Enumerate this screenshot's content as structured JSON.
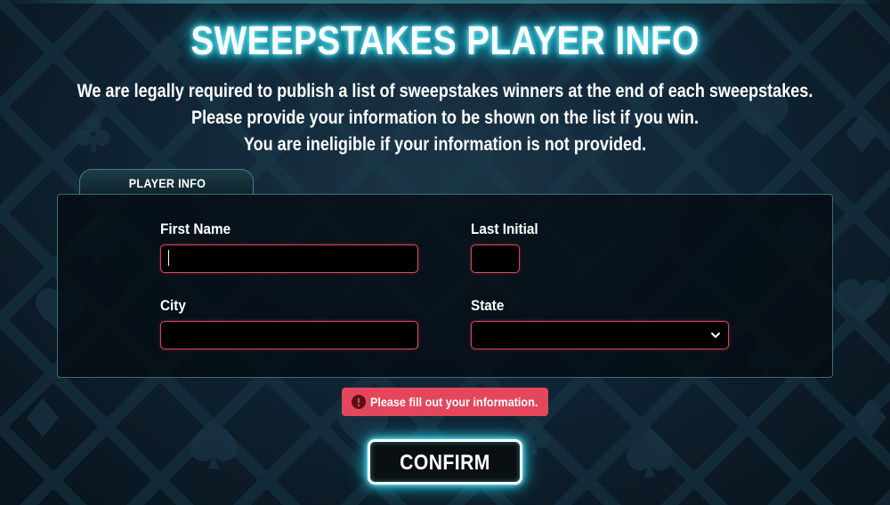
{
  "title": "SWEEPSTAKES PLAYER INFO",
  "notice": {
    "line1": "We are legally required to publish a list of sweepstakes winners at the end of each sweepstakes.",
    "line2": "Please provide your information to be shown on the list if you win.",
    "line3": "You are ineligible if your information is not provided."
  },
  "panel": {
    "tab_label": "PLAYER INFO"
  },
  "fields": {
    "first_name": {
      "label": "First Name",
      "value": ""
    },
    "last_initial": {
      "label": "Last Initial",
      "value": ""
    },
    "city": {
      "label": "City",
      "value": ""
    },
    "state": {
      "label": "State",
      "value": "",
      "icon": "chevron-down-icon"
    }
  },
  "error": {
    "icon": "alert-circle-icon",
    "message": "Please fill out your information."
  },
  "confirm_label": "CONFIRM",
  "colors": {
    "title_glow": "#34d5ea",
    "input_border": "#e0445d",
    "error_bg": "#e4475c",
    "panel_border": "#3a6f78"
  }
}
